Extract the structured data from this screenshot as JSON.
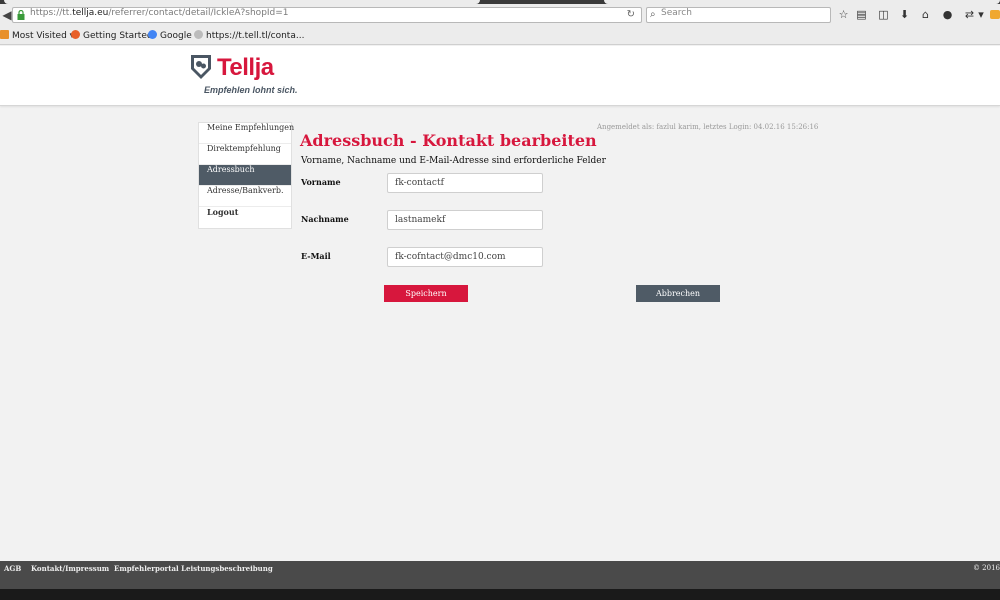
{
  "browser": {
    "url_prefix": "https://tt.",
    "url_domain": "tellja.eu",
    "url_path": "/referrer/contact/detail/IckleA?shopId=1",
    "search_placeholder": "Search",
    "bookmarks": [
      {
        "label": "Most Visited",
        "icon": "star-icon"
      },
      {
        "label": "Getting Started",
        "icon": "firefox-icon"
      },
      {
        "label": "Google",
        "icon": "google-icon"
      },
      {
        "label": "https://t.tell.tl/conta...",
        "icon": "globe-icon"
      }
    ]
  },
  "brand": {
    "name": "Tellja",
    "tagline": "Empfehlen lohnt sich.",
    "accent": "#d7173d",
    "dark": "#4f5b66"
  },
  "sidebar": {
    "items": [
      {
        "label": "Meine Empfehlungen"
      },
      {
        "label": "Direktempfehlung"
      },
      {
        "label": "Adressbuch"
      },
      {
        "label": "Adresse/Bankverb."
      },
      {
        "label": "Logout"
      }
    ]
  },
  "status": "Angemeldet als: fazlul karim, letztes Login: 04.02.16 15:26:16",
  "form": {
    "title": "Adressbuch - Kontakt bearbeiten",
    "required_note": "Vorname, Nachname und E-Mail-Adresse sind erforderliche Felder",
    "fields": {
      "firstname": {
        "label": "Vorname",
        "value": "fk-contactf"
      },
      "lastname": {
        "label": "Nachname",
        "value": "lastnamekf"
      },
      "email": {
        "label": "E-Mail",
        "value": "fk-cofntact@dmc10.com"
      }
    },
    "save_label": "Speichern",
    "cancel_label": "Abbrechen"
  },
  "footer": {
    "links": [
      "AGB",
      "Kontakt/Impressum",
      "Empfehlerportal Leistungsbeschreibung"
    ],
    "copyright": "© 2016"
  }
}
